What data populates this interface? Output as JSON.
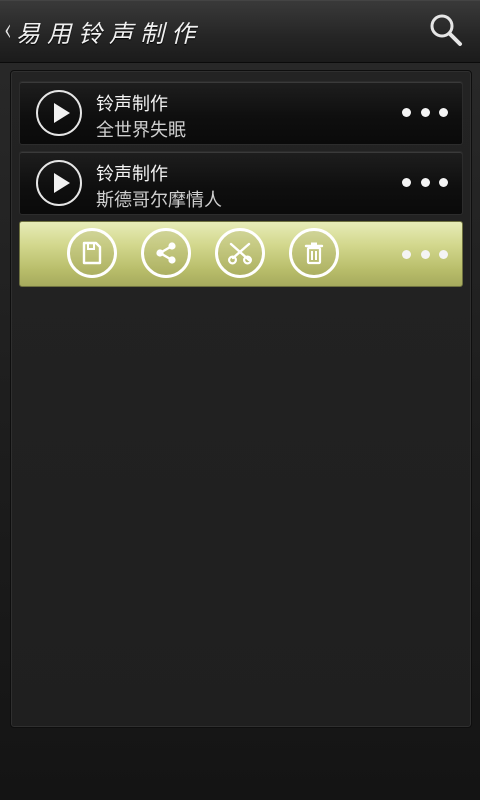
{
  "header": {
    "back_chevron": "‹",
    "title": "易用铃声制作",
    "search_icon": "search-icon"
  },
  "list": {
    "items": [
      {
        "title": "铃声制作",
        "subtitle": "全世界失眠"
      },
      {
        "title": "铃声制作",
        "subtitle": "斯德哥尔摩情人"
      }
    ]
  },
  "action_bar": {
    "icons": [
      "save-icon",
      "share-icon",
      "cut-icon",
      "delete-icon"
    ],
    "more_icon": "more-icon"
  },
  "colors": {
    "accent_bar": "#d3d88e",
    "background": "#1f1f1f",
    "text": "#f2f2f2"
  }
}
